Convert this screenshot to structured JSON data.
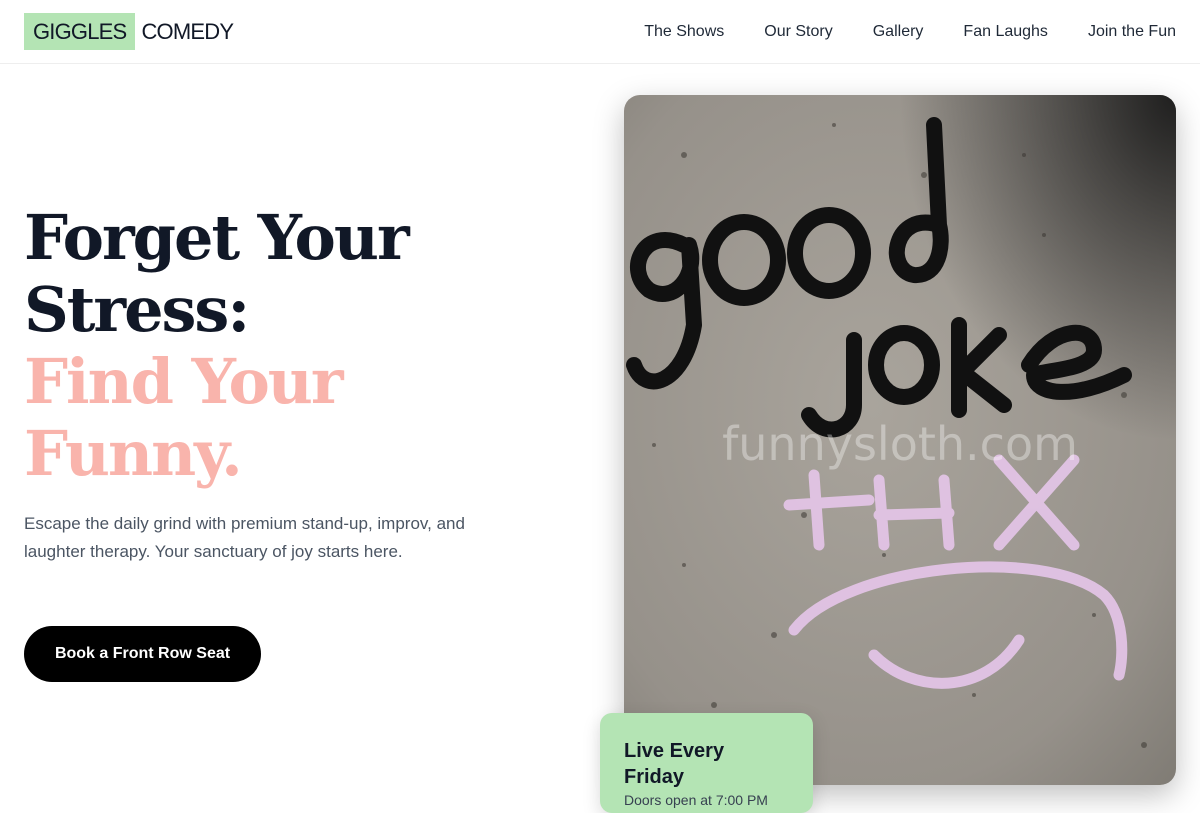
{
  "header": {
    "logo_highlight": "GIGGLES",
    "logo_rest": "COMEDY",
    "nav": [
      {
        "label": "The Shows"
      },
      {
        "label": "Our Story"
      },
      {
        "label": "Gallery"
      },
      {
        "label": "Fan Laughs"
      },
      {
        "label": "Join the Fun"
      }
    ]
  },
  "hero": {
    "title_line1": "Forget Your",
    "title_line2": "Stress:",
    "title_line3": "Find Your",
    "title_line4": "Funny.",
    "subtitle": "Escape the daily grind with premium stand-up, improv, and laughter therapy. Your sanctuary of joy starts here.",
    "cta_label": "Book a Front Row Seat"
  },
  "photo": {
    "watermark": "funnysloth.com",
    "colors": {
      "wall": "#9c978f",
      "ink": "#111111",
      "chalk": "#e6c6ea"
    }
  },
  "badge": {
    "title": "Live Every Friday",
    "subtitle": "Doors open at 7:00 PM"
  },
  "colors": {
    "accent_green": "#b4e4b4",
    "accent_pink": "#f9b4ac",
    "button": "#000000"
  }
}
